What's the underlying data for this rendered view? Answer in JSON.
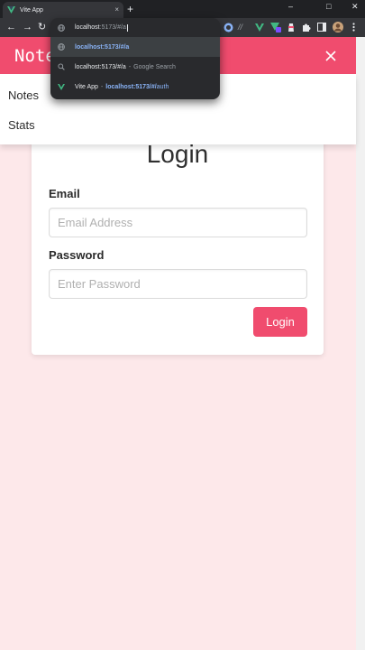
{
  "browser": {
    "tab": {
      "title": "Vite App",
      "close_glyph": "×",
      "favicon": "vue-logo-icon"
    },
    "new_tab_glyph": "+",
    "window_controls": {
      "minimize": "–",
      "maximize": "□",
      "close": "✕"
    },
    "omnibox": {
      "typed": "localhost",
      "autocomplete": ":5173/#/a",
      "suggestions": [
        {
          "icon": "globe-icon",
          "url": "localhost:5173/#/a",
          "active": true
        },
        {
          "icon": "search-icon",
          "text": "localhost:5173/#/a",
          "suffix": "Google Search"
        },
        {
          "icon": "vue-logo-icon",
          "title": "Vite App",
          "url": "localhost:5173/#/",
          "url_rest": "auth"
        }
      ]
    },
    "nav_glyphs": {
      "back": "←",
      "forward": "→",
      "reload": "↻"
    },
    "extension_text": "//"
  },
  "app": {
    "brand": "Noteballs",
    "brand_visible": "Note",
    "menu": [
      "Notes",
      "Stats"
    ],
    "login": {
      "title": "Login",
      "email_label": "Email",
      "email_placeholder": "Email Address",
      "password_label": "Password",
      "password_placeholder": "Enter Password",
      "submit_label": "Login"
    }
  },
  "colors": {
    "accent": "#f04c6e",
    "page_background": "#fde8ea",
    "vue_green": "#41b883"
  }
}
